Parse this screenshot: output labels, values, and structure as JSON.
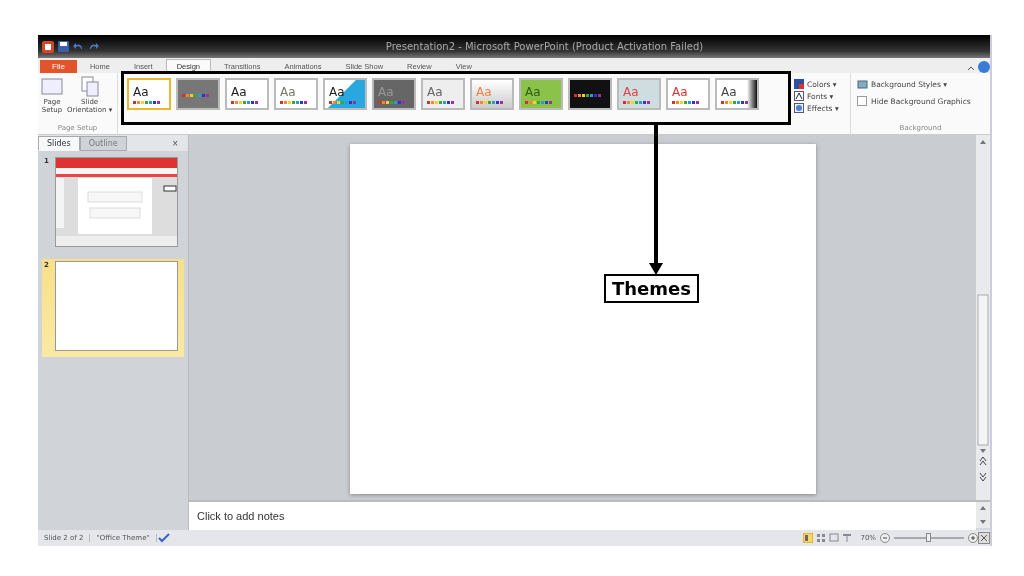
{
  "window": {
    "title": "Presentation2 - Microsoft PowerPoint (Product Activation Failed)"
  },
  "file_tab": "File",
  "tabs": [
    {
      "label": "Home",
      "selected": false
    },
    {
      "label": "Insert",
      "selected": false
    },
    {
      "label": "Design",
      "selected": true
    },
    {
      "label": "Transitions",
      "selected": false
    },
    {
      "label": "Animations",
      "selected": false
    },
    {
      "label": "Slide Show",
      "selected": false
    },
    {
      "label": "Review",
      "selected": false
    },
    {
      "label": "View",
      "selected": false
    }
  ],
  "page_setup": {
    "buttons": [
      {
        "kind": "page",
        "label": "Page\nSetup"
      },
      {
        "kind": "orientation",
        "label": "Slide\nOrientation ▾"
      }
    ],
    "group_label": "Page Setup"
  },
  "themes": [
    {
      "label": "Aa",
      "selected": true
    },
    {
      "selected": false
    },
    {
      "label": "Aa",
      "selected": false
    },
    {
      "label": "Aa",
      "selected": false
    },
    {
      "label": "Aa",
      "selected": false
    },
    {
      "label": "Aa",
      "selected": false
    },
    {
      "label": "Aa",
      "selected": false
    },
    {
      "label": "Aa",
      "selected": false
    },
    {
      "label": "Aa",
      "selected": false
    },
    {
      "selected": false
    },
    {
      "label": "Aa",
      "selected": false
    },
    {
      "label": "Aa",
      "selected": false
    },
    {
      "label": "Aa",
      "selected": false
    }
  ],
  "theme_options": [
    {
      "kind": "colors",
      "label": "Colors ▾"
    },
    {
      "kind": "fonts",
      "label": "Fonts ▾"
    },
    {
      "kind": "effects",
      "label": "Effects ▾"
    }
  ],
  "background": {
    "styles_button": "Background Styles ▾",
    "hide_graphics": {
      "label": "Hide Background Graphics",
      "checked": false
    },
    "group_label": "Background"
  },
  "slides_pane": {
    "tabs": [
      {
        "label": "Slides",
        "selected": true
      },
      {
        "label": "Outline",
        "selected": false
      }
    ],
    "close": "×",
    "slides": [
      {
        "number": "1",
        "selected": false,
        "kind": "picture"
      },
      {
        "number": "2",
        "selected": true
      }
    ]
  },
  "notes": {
    "placeholder": "Click to add notes"
  },
  "status_bar": {
    "slide": "Slide 2 of 2",
    "theme": "\"Office Theme\"",
    "zoom": "70%",
    "zoom_slider": {
      "level": 0.5
    }
  },
  "annotation": {
    "callout": "Themes"
  }
}
